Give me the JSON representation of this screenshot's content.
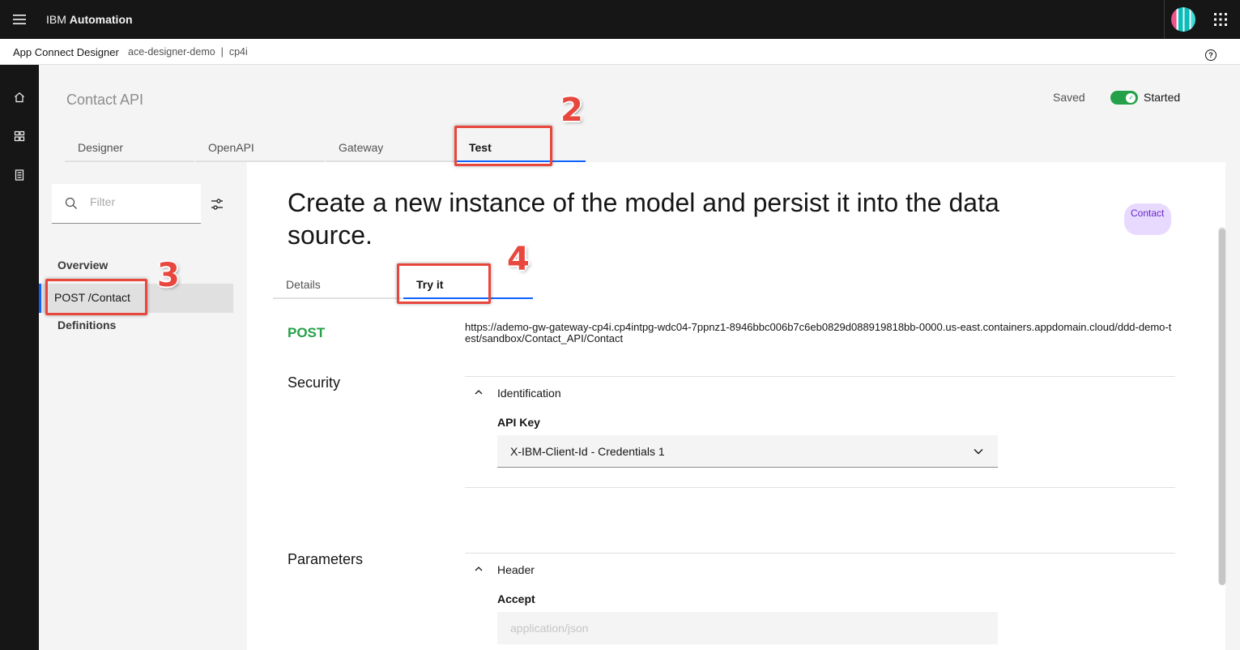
{
  "topbar": {
    "brand_prefix": "IBM",
    "brand_name": "Automation"
  },
  "crumbs": {
    "app": "App Connect Designer",
    "instance": "ace-designer-demo  |  cp4i",
    "help_glyph": "?"
  },
  "rail": {
    "items": [
      "home-icon",
      "catalog-icon",
      "document-icon"
    ]
  },
  "header": {
    "title": "Contact API",
    "saved_label": "Saved",
    "toggle_state": "on",
    "started_label": "Started"
  },
  "tabs": [
    {
      "label": "Designer"
    },
    {
      "label": "OpenAPI"
    },
    {
      "label": "Gateway"
    },
    {
      "label": "Test",
      "active": true
    }
  ],
  "leftpanel": {
    "filter_placeholder": "Filter",
    "items": [
      {
        "label": "Overview"
      },
      {
        "label": "POST /Contact",
        "selected": true
      },
      {
        "label": "Definitions"
      }
    ]
  },
  "operation": {
    "title": "Create a new instance of the model and persist it into the data source.",
    "tag": "Contact",
    "subtabs": [
      {
        "label": "Details"
      },
      {
        "label": "Try it",
        "active": true
      }
    ],
    "method": "POST",
    "url": "https://ademo-gw-gateway-cp4i.cp4intpg-wdc04-7ppnz1-8946bbc006b7c6eb0829d088919818bb-0000.us-east.containers.appdomain.cloud/ddd-demo-test/sandbox/Contact_API/Contact",
    "security": {
      "label": "Security",
      "section": "Identification",
      "field_label": "API Key",
      "field_value": "X-IBM-Client-Id - Credentials 1"
    },
    "parameters": {
      "label": "Parameters",
      "section": "Header",
      "field_label": "Accept",
      "field_value": "application/json"
    }
  },
  "annotations": [
    "2",
    "3",
    "4"
  ],
  "colors": {
    "accent": "#0f62fe",
    "success": "#24a148",
    "annotation": "#e8473e",
    "tag_bg": "#e8daff"
  }
}
